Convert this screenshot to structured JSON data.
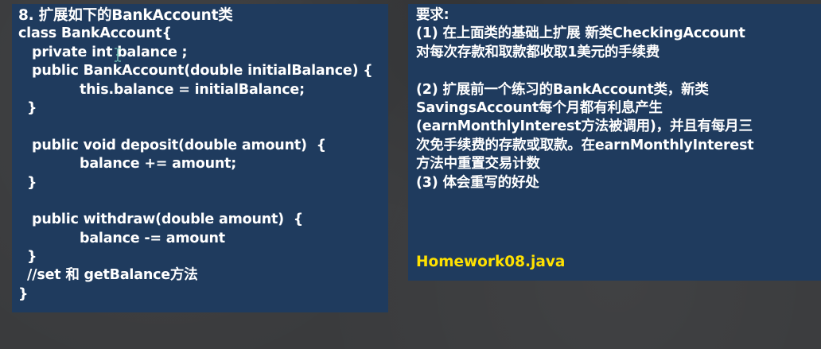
{
  "left_panel": {
    "title": "8. 扩展如下的BankAccount类",
    "code_lines": [
      "class BankAccount{",
      "private int balance ;",
      "public BankAccount(double initialBalance) {",
      "this.balance = initialBalance;",
      "}",
      "public void deposit(double amount)  {",
      "balance += amount;",
      "}",
      "public withdraw(double amount)  {",
      "balance -= amount",
      "}",
      "//set 和 getBalance方法",
      "}"
    ]
  },
  "right_panel": {
    "heading": "要求:",
    "req1_lines": [
      "(1) 在上面类的基础上扩展 新类CheckingAccount",
      "对每次存款和取款都收取1美元的手续费"
    ],
    "req2_lines": [
      "(2) 扩展前一个练习的BankAccount类，新类",
      "SavingsAccount每个月都有利息产生",
      "(earnMonthlyInterest方法被调用)，并且有每月三",
      "次免手续费的存款或取款。在earnMonthlyInterest",
      "方法中重置交易计数"
    ],
    "req3": "(3) 体会重写的好处",
    "homework_file": "Homework08.java",
    "homework_color": "#ffe100"
  },
  "colors": {
    "panel_bg": "#1f3b5e",
    "background": "#3a3b3d",
    "text": "#ffffff"
  },
  "icons": {
    "cursor": "text-cursor-icon"
  }
}
